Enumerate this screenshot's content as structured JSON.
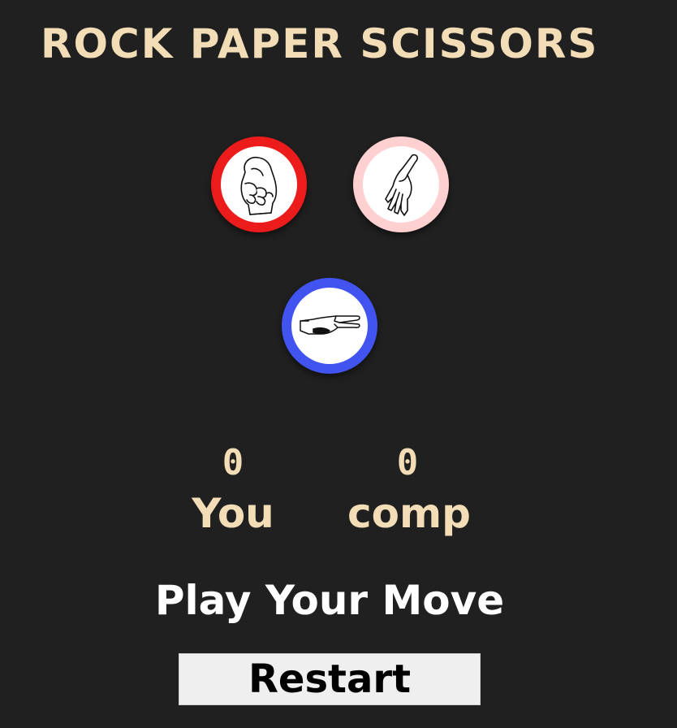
{
  "title": "ROCK PAPER SCISSORS",
  "choices": [
    {
      "id": "rock",
      "icon": "rock-fist-icon",
      "ring_color": "#ec1c1c"
    },
    {
      "id": "paper",
      "icon": "paper-hand-icon",
      "ring_color": "#ffd0d0"
    },
    {
      "id": "scissors",
      "icon": "scissors-hand-icon",
      "ring_color": "#4254f0"
    }
  ],
  "score": {
    "user": "0",
    "user_label": "You",
    "comp": "0",
    "comp_label": "comp"
  },
  "message": "Play Your Move",
  "restart_label": "Restart",
  "colors": {
    "background": "#202020",
    "accent_text": "#f2ddb6",
    "message_text": "#ffffff"
  }
}
